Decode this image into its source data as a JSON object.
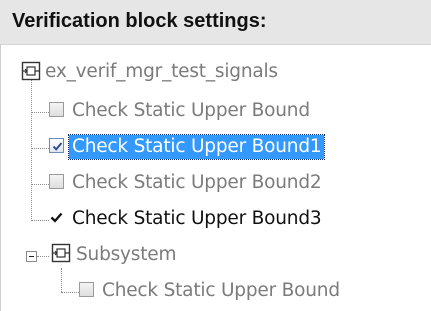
{
  "header": {
    "title": "Verification block settings:"
  },
  "tree": {
    "root": {
      "label": "ex_verif_mgr_test_signals"
    },
    "items": [
      {
        "label": "Check Static  Upper Bound",
        "checked": false,
        "state": "disabled"
      },
      {
        "label": "Check Static  Upper Bound1",
        "checked": true,
        "state": "selected"
      },
      {
        "label": "Check Static  Upper Bound2",
        "checked": false,
        "state": "disabled"
      },
      {
        "label": "Check Static  Upper Bound3",
        "checked": true,
        "state": "enabled"
      }
    ],
    "subsystem": {
      "label": "Subsystem",
      "expanded": true,
      "children": [
        {
          "label": "Check Static  Upper Bound",
          "checked": false,
          "state": "disabled"
        }
      ]
    }
  },
  "colors": {
    "selection": "#3399ff",
    "disabled_text": "#7b7b7b",
    "header_bg": "#e6e6e6"
  }
}
